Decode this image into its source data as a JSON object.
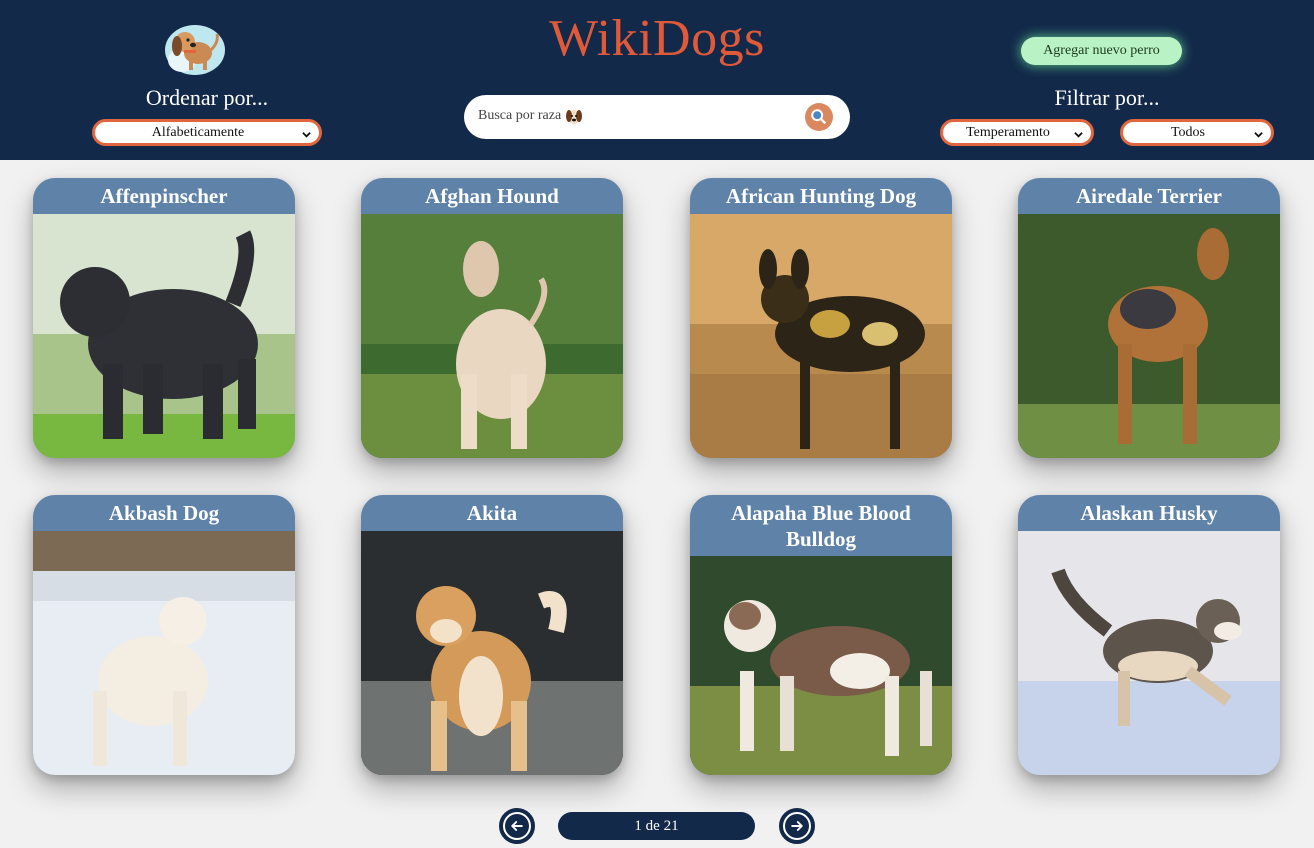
{
  "header": {
    "brand": "WikiDogs",
    "sort_label": "Ordenar por...",
    "sort_selected": "Alfabeticamente",
    "search_placeholder": "Busca por raza",
    "add_button": "Agregar nuevo perro",
    "filter_label": "Filtrar por...",
    "filter_type_selected": "Temperamento",
    "filter_value_selected": "Todos"
  },
  "cards": [
    {
      "name": "Affenpinscher"
    },
    {
      "name": "Afghan Hound"
    },
    {
      "name": "African Hunting Dog"
    },
    {
      "name": "Airedale Terrier"
    },
    {
      "name": "Akbash Dog"
    },
    {
      "name": "Akita"
    },
    {
      "name": "Alapaha Blue Blood Bulldog"
    },
    {
      "name": "Alaskan Husky"
    }
  ],
  "pagination": {
    "indicator": "1 de 21"
  },
  "colors": {
    "header_bg": "#12294a",
    "brand": "#e05a3a",
    "select_border": "#e2663d",
    "card_header": "#5f82a8",
    "add_button": "#b9f3c5"
  },
  "icons": {
    "logo": "dog-logo-icon",
    "search": "search-icon",
    "prev": "arrow-left-icon",
    "next": "arrow-right-icon"
  }
}
